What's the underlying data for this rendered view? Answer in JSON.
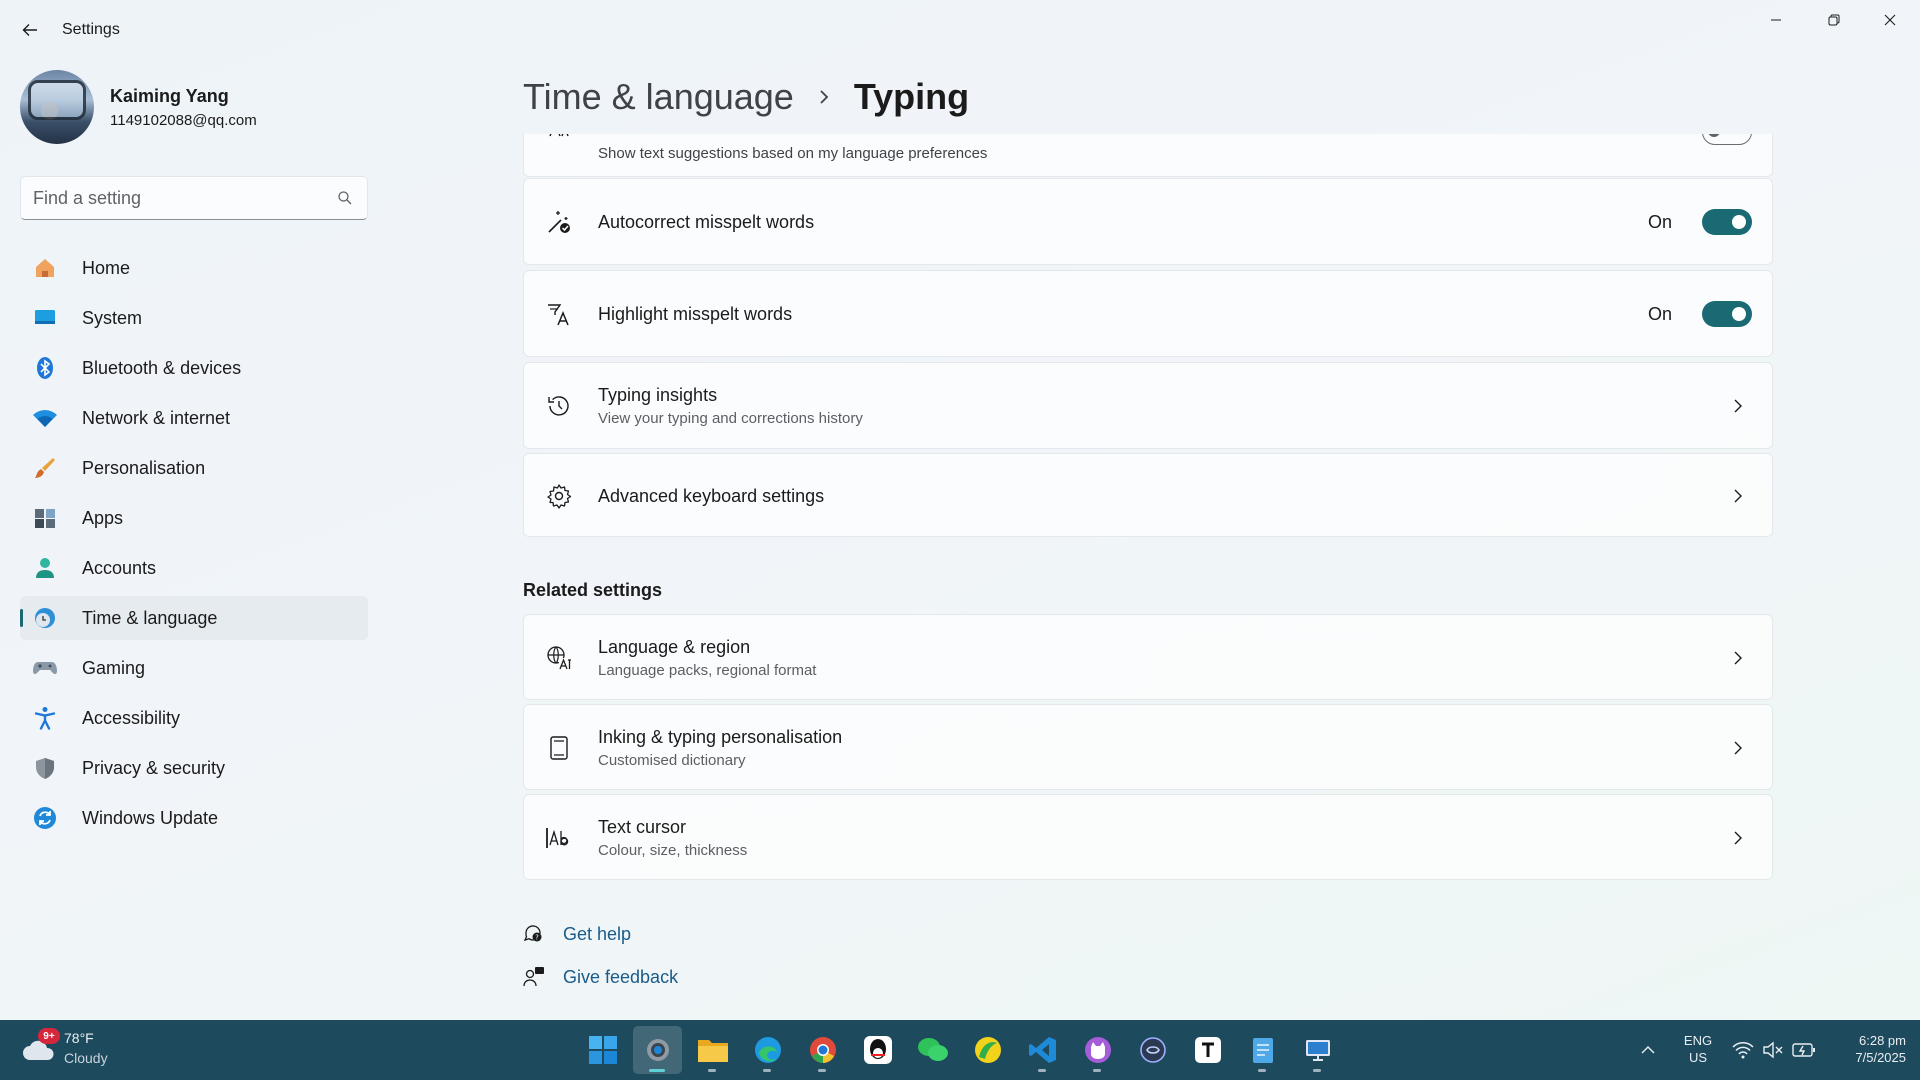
{
  "window": {
    "title": "Settings",
    "controls": [
      "minimize-icon",
      "restore-icon",
      "close-icon"
    ]
  },
  "user": {
    "name": "Kaiming Yang",
    "email": "1149102088@qq.com"
  },
  "search": {
    "placeholder": "Find a setting"
  },
  "sidebar": {
    "active": "Time & language",
    "items": [
      {
        "label": "Home",
        "icon": "home-icon"
      },
      {
        "label": "System",
        "icon": "system-icon"
      },
      {
        "label": "Bluetooth & devices",
        "icon": "bluetooth-icon"
      },
      {
        "label": "Network & internet",
        "icon": "wifi-icon"
      },
      {
        "label": "Personalisation",
        "icon": "brush-icon"
      },
      {
        "label": "Apps",
        "icon": "apps-icon"
      },
      {
        "label": "Accounts",
        "icon": "person-icon"
      },
      {
        "label": "Time & language",
        "icon": "globe-clock-icon"
      },
      {
        "label": "Gaming",
        "icon": "gamepad-icon"
      },
      {
        "label": "Accessibility",
        "icon": "accessibility-icon"
      },
      {
        "label": "Privacy & security",
        "icon": "shield-icon"
      },
      {
        "label": "Windows Update",
        "icon": "update-icon"
      }
    ]
  },
  "breadcrumb": {
    "parent": "Time & language",
    "current": "Typing"
  },
  "settings": {
    "text_suggestions": {
      "subtitle": "Show text suggestions based on my language preferences",
      "state": "On"
    },
    "autocorrect": {
      "title": "Autocorrect misspelt words",
      "state": "On"
    },
    "highlight": {
      "title": "Highlight misspelt words",
      "state": "On"
    },
    "typing_insights": {
      "title": "Typing insights",
      "subtitle": "View your typing and corrections history"
    },
    "advanced_keyboard": {
      "title": "Advanced keyboard settings"
    }
  },
  "related": {
    "heading": "Related settings",
    "items": [
      {
        "title": "Language & region",
        "subtitle": "Language packs, regional format"
      },
      {
        "title": "Inking & typing personalisation",
        "subtitle": "Customised dictionary"
      },
      {
        "title": "Text cursor",
        "subtitle": "Colour, size, thickness"
      }
    ]
  },
  "help": {
    "get_help": "Get help",
    "give_feedback": "Give feedback"
  },
  "taskbar": {
    "weather": {
      "badge": "9+",
      "temp": "78°F",
      "condition": "Cloudy"
    },
    "apps": [
      "start-icon",
      "settings-icon",
      "file-explorer-icon",
      "edge-icon",
      "chrome-icon",
      "qq-icon",
      "wechat-icon",
      "app-green-icon",
      "vscode-icon",
      "cat-app-icon",
      "copilot-icon",
      "typora-icon",
      "notepad-icon",
      "remote-desktop-icon"
    ],
    "language": {
      "line1": "ENG",
      "line2": "US"
    },
    "clock": {
      "time": "6:28 pm",
      "date": "7/5/2025"
    }
  },
  "colors": {
    "accent": "#1a6a73",
    "link": "#1a5b8a",
    "taskbar": "#1e4a5e"
  }
}
